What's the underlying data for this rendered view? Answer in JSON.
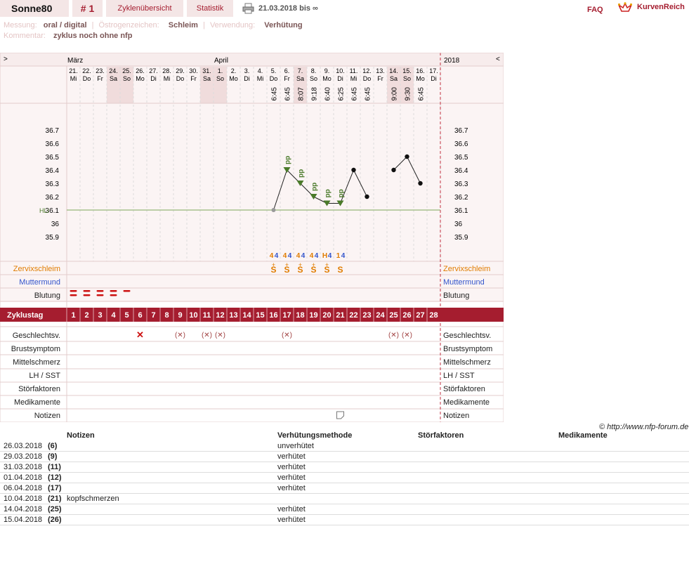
{
  "header": {
    "user": "Sonne80",
    "cycle_num": "# 1",
    "tab_overview": "Zyklenübersicht",
    "tab_stats": "Statistik",
    "date_range": "21.03.2018 bis ∞",
    "faq": "FAQ",
    "brand": "KurvenReich"
  },
  "meta": {
    "messung_label": "Messung:",
    "messung_value": "oral / digital",
    "oestrogen_label": "Östrogenzeichen:",
    "oestrogen_value": "Schleim",
    "verwendung_label": "Verwendung:",
    "verwendung_value": "Verhütung",
    "kommentar_label": "Kommentar:",
    "kommentar_value": "zyklus noch ohne nfp"
  },
  "chart_data": {
    "type": "line",
    "title": "",
    "left_arrow": ">",
    "right_arrow": "<",
    "year_label": "2018",
    "month_labels": [
      {
        "label": "März",
        "day_index": 0
      },
      {
        "label": "April",
        "day_index": 11
      }
    ],
    "days": [
      {
        "date": "21.",
        "wd": "Mi"
      },
      {
        "date": "22.",
        "wd": "Do"
      },
      {
        "date": "23.",
        "wd": "Fr"
      },
      {
        "date": "24.",
        "wd": "Sa"
      },
      {
        "date": "25.",
        "wd": "So"
      },
      {
        "date": "26.",
        "wd": "Mo"
      },
      {
        "date": "27.",
        "wd": "Di"
      },
      {
        "date": "28.",
        "wd": "Mi"
      },
      {
        "date": "29.",
        "wd": "Do"
      },
      {
        "date": "30.",
        "wd": "Fr"
      },
      {
        "date": "31.",
        "wd": "Sa"
      },
      {
        "date": "1.",
        "wd": "So"
      },
      {
        "date": "2.",
        "wd": "Mo"
      },
      {
        "date": "3.",
        "wd": "Di"
      },
      {
        "date": "4.",
        "wd": "Mi"
      },
      {
        "date": "5.",
        "wd": "Do"
      },
      {
        "date": "6.",
        "wd": "Fr"
      },
      {
        "date": "7.",
        "wd": "Sa"
      },
      {
        "date": "8.",
        "wd": "So"
      },
      {
        "date": "9.",
        "wd": "Mo"
      },
      {
        "date": "10.",
        "wd": "Di"
      },
      {
        "date": "11.",
        "wd": "Mi"
      },
      {
        "date": "12.",
        "wd": "Do"
      },
      {
        "date": "13.",
        "wd": "Fr"
      },
      {
        "date": "14.",
        "wd": "Sa"
      },
      {
        "date": "15.",
        "wd": "So"
      },
      {
        "date": "16.",
        "wd": "Mo"
      },
      {
        "date": "17.",
        "wd": "Di"
      }
    ],
    "weekend_days": [
      4,
      5,
      11,
      12,
      18,
      25,
      26
    ],
    "times": {
      "16": "6:45",
      "17": "6:45",
      "18": "8:07",
      "19": "9:18",
      "20": "6:40",
      "21": "6:25",
      "22": "6:45",
      "23": "6:45",
      "25": "9:00",
      "26": "9:30",
      "27": "6:45"
    },
    "y_ticks": [
      "36.7",
      "36.6",
      "36.5",
      "36.4",
      "36.3",
      "36.2",
      "36.1",
      "36",
      "35.9"
    ],
    "ylim": [
      35.9,
      36.7
    ],
    "hili_label": "HLi",
    "hili_value": 36.1,
    "temps": [
      {
        "day": 16,
        "value": 36.1,
        "marker": "gray"
      },
      {
        "day": 17,
        "value": 36.4,
        "marker": "triangle",
        "label": "pp"
      },
      {
        "day": 18,
        "value": 36.3,
        "marker": "triangle",
        "label": "pp"
      },
      {
        "day": 19,
        "value": 36.2,
        "marker": "triangle",
        "label": "pp"
      },
      {
        "day": 20,
        "value": 36.15,
        "marker": "triangle",
        "label": "pp"
      },
      {
        "day": 21,
        "value": 36.15,
        "marker": "triangle",
        "label": "pp"
      },
      {
        "day": 22,
        "value": 36.4,
        "marker": "dot"
      },
      {
        "day": 23,
        "value": 36.2,
        "marker": "dot"
      },
      {
        "day": 25,
        "value": 36.4,
        "marker": "dot"
      },
      {
        "day": 26,
        "value": 36.5,
        "marker": "dot"
      },
      {
        "day": 27,
        "value": 36.3,
        "marker": "dot"
      }
    ],
    "cervix_codes": [
      {
        "day": 16,
        "a": "4",
        "b": "4"
      },
      {
        "day": 17,
        "a": "4",
        "b": "4"
      },
      {
        "day": 18,
        "a": "4",
        "b": "4"
      },
      {
        "day": 19,
        "a": "4",
        "b": "4"
      },
      {
        "day": 20,
        "a": "H",
        "b": "4"
      },
      {
        "day": 21,
        "a": "1",
        "b": "4"
      }
    ],
    "mucus": [
      {
        "day": 16,
        "sym": "S",
        "plus": "+"
      },
      {
        "day": 17,
        "sym": "S",
        "plus": "+"
      },
      {
        "day": 18,
        "sym": "S",
        "plus": "+"
      },
      {
        "day": 19,
        "sym": "S",
        "plus": "+"
      },
      {
        "day": 20,
        "sym": "S",
        "plus": "+"
      },
      {
        "day": 21,
        "sym": "S",
        "plus": ""
      }
    ],
    "bleeding_days": [
      1,
      2,
      3,
      4,
      5
    ],
    "bleeding_strength": [
      "heavy",
      "heavy",
      "heavy",
      "heavy",
      "light"
    ],
    "labels_left": [
      "Zervixschleim",
      "Muttermund",
      "Blutung",
      "Zyklustag",
      "Geschlechtsv.",
      "Brustsymptom",
      "Mittelschmerz",
      "LH / SST",
      "Störfaktoren",
      "Medikamente",
      "Notizen"
    ],
    "cycle_days": [
      "1",
      "2",
      "3",
      "4",
      "5",
      "6",
      "7",
      "8",
      "9",
      "10",
      "11",
      "12",
      "13",
      "14",
      "15",
      "16",
      "17",
      "18",
      "19",
      "20",
      "21",
      "22",
      "23",
      "24",
      "25",
      "26",
      "27",
      "28"
    ],
    "intercourse": [
      {
        "day": 6,
        "kind": "unprotected",
        "symbol": "✕"
      },
      {
        "day": 9,
        "kind": "protected",
        "symbol": "(✕)"
      },
      {
        "day": 11,
        "kind": "protected",
        "symbol": "(✕)"
      },
      {
        "day": 12,
        "kind": "protected",
        "symbol": "(✕)"
      },
      {
        "day": 17,
        "kind": "protected",
        "symbol": "(✕)"
      },
      {
        "day": 25,
        "kind": "protected",
        "symbol": "(✕)"
      },
      {
        "day": 26,
        "kind": "protected",
        "symbol": "(✕)"
      }
    ],
    "note_days": [
      21
    ],
    "colors": {
      "accent": "#a51d2f",
      "zervix": "#e07c00",
      "muttermund": "#3355cc",
      "green": "#4a7a2a",
      "blood": "#cc1111"
    }
  },
  "copyright": "© http://www.nfp-forum.de",
  "table": {
    "headers": [
      "Notizen",
      "Verhütungsmethode",
      "Störfaktoren",
      "Medikamente"
    ],
    "rows": [
      {
        "date": "26.03.2018",
        "num": "(6)",
        "note": "",
        "method": "unverhütet"
      },
      {
        "date": "29.03.2018",
        "num": "(9)",
        "note": "",
        "method": "verhütet"
      },
      {
        "date": "31.03.2018",
        "num": "(11)",
        "note": "",
        "method": "verhütet"
      },
      {
        "date": "01.04.2018",
        "num": "(12)",
        "note": "",
        "method": "verhütet"
      },
      {
        "date": "06.04.2018",
        "num": "(17)",
        "note": "",
        "method": "verhütet"
      },
      {
        "date": "10.04.2018",
        "num": "(21)",
        "note": "kopfschmerzen",
        "method": ""
      },
      {
        "date": "14.04.2018",
        "num": "(25)",
        "note": "",
        "method": "verhütet"
      },
      {
        "date": "15.04.2018",
        "num": "(26)",
        "note": "",
        "method": "verhütet"
      }
    ]
  }
}
